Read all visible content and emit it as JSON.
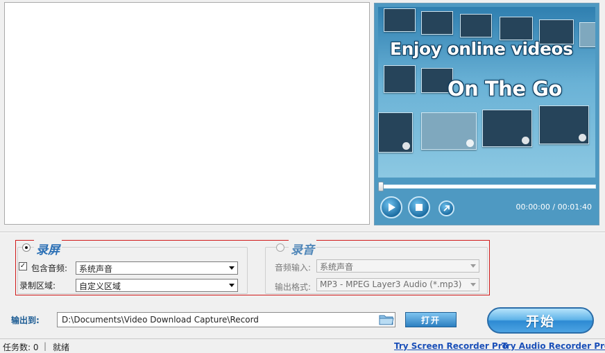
{
  "preview": {
    "promo_line1": "Enjoy online videos",
    "promo_line2": "On The Go",
    "time": "00:00:00 / 00:01:40",
    "progress": 0
  },
  "screen_group": {
    "title": "录屏",
    "selected": true,
    "include_audio_label": "包含音频:",
    "include_audio_checked": true,
    "audio_source_value": "系统声音",
    "record_area_label": "录制区域:",
    "record_area_value": "自定义区域"
  },
  "audio_group": {
    "title": "录音",
    "selected": false,
    "input_label": "音频输入:",
    "input_value": "系统声音",
    "format_label": "输出格式:",
    "format_value": "MP3 - MPEG Layer3 Audio (*.mp3)"
  },
  "output": {
    "label": "输出到:",
    "path": "D:\\Documents\\Video Download Capture\\Record",
    "open_label": "打开"
  },
  "start_label": "开始",
  "status": {
    "task_count": "任务数: 0",
    "separator": "|",
    "state": "就绪"
  },
  "links": {
    "screen_recorder": "Try Screen Recorder Pro",
    "audio_recorder": "Try Audio Recorder Pro"
  },
  "colors": {
    "accent": "#2a6fb5",
    "highlight_border": "#d01818",
    "link": "#1a4fb8"
  }
}
